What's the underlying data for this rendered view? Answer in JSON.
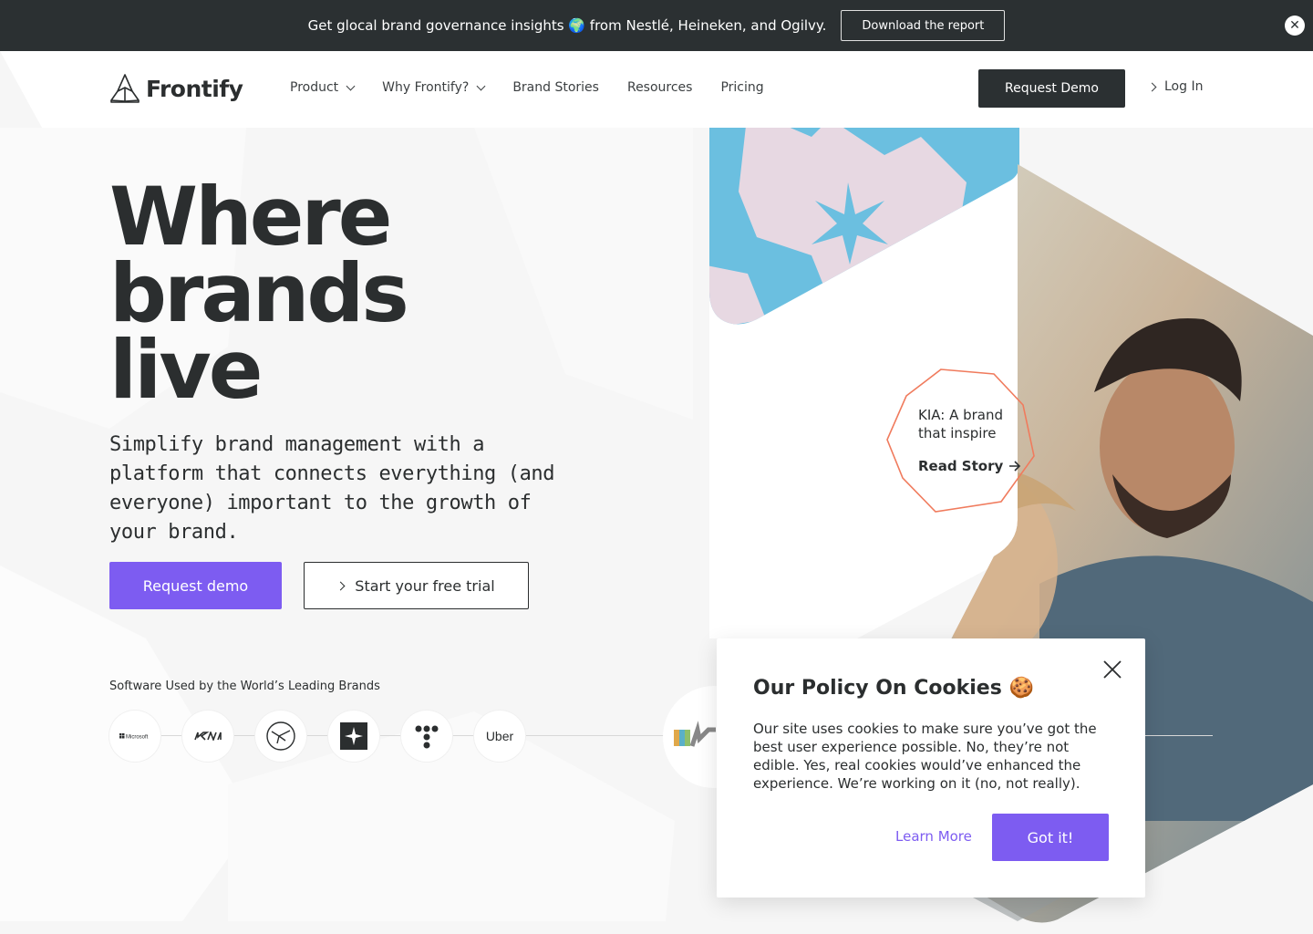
{
  "announcement": {
    "text": "Get glocal brand governance insights 🌍 from Nestlé, Heineken, and Ogilvy.",
    "button": "Download the report",
    "close": "✕"
  },
  "nav": {
    "logo": "Frontify",
    "items": [
      {
        "label": "Product",
        "dropdown": true
      },
      {
        "label": "Why Frontify?",
        "dropdown": true
      },
      {
        "label": "Brand Stories",
        "dropdown": false
      },
      {
        "label": "Resources",
        "dropdown": false
      },
      {
        "label": "Pricing",
        "dropdown": false
      }
    ],
    "request_demo": "Request Demo",
    "login": "Log In"
  },
  "hero": {
    "title_line1": "Where",
    "title_line2": "brands",
    "title_line3": "live",
    "subtitle": "Simplify brand management with a platform that connects everything (and everyone) important to the growth of your brand.",
    "primary_button": "Request demo",
    "secondary_button": "Start your free trial"
  },
  "brands": {
    "label": "Software Used by the World’s Leading Brands",
    "logos": [
      "Microsoft",
      "KIA",
      "Lufthansa",
      "Starbucks-mark",
      "T",
      "Uber"
    ]
  },
  "story_card": {
    "title": "KIA: A brand that inspire",
    "link": "Read Story"
  },
  "cookie": {
    "title": "Our Policy On Cookies 🍪",
    "text": "Our site uses cookies to make sure you’ve got the best user experience possible. No, they’re not edible. Yes, real cookies would’ve enhanced the experience. We’re working on it (no, not really).",
    "learn_more": "Learn More",
    "accept": "Got it!"
  },
  "colors": {
    "dark": "#2b3032",
    "accent": "#7d5cf1",
    "story_outline": "#f07b5d",
    "pattern_blue": "#6bbfe0",
    "pattern_pink": "#e7d8e2"
  }
}
